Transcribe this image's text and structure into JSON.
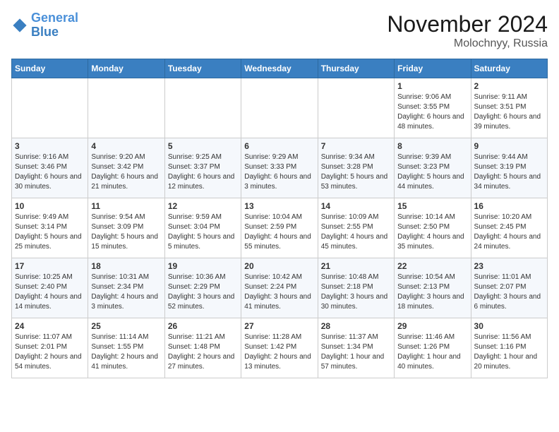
{
  "header": {
    "logo_line1": "General",
    "logo_line2": "Blue",
    "month": "November 2024",
    "location": "Molochnyy, Russia"
  },
  "days_of_week": [
    "Sunday",
    "Monday",
    "Tuesday",
    "Wednesday",
    "Thursday",
    "Friday",
    "Saturday"
  ],
  "weeks": [
    [
      {
        "day": "",
        "info": ""
      },
      {
        "day": "",
        "info": ""
      },
      {
        "day": "",
        "info": ""
      },
      {
        "day": "",
        "info": ""
      },
      {
        "day": "",
        "info": ""
      },
      {
        "day": "1",
        "info": "Sunrise: 9:06 AM\nSunset: 3:55 PM\nDaylight: 6 hours and 48 minutes."
      },
      {
        "day": "2",
        "info": "Sunrise: 9:11 AM\nSunset: 3:51 PM\nDaylight: 6 hours and 39 minutes."
      }
    ],
    [
      {
        "day": "3",
        "info": "Sunrise: 9:16 AM\nSunset: 3:46 PM\nDaylight: 6 hours and 30 minutes."
      },
      {
        "day": "4",
        "info": "Sunrise: 9:20 AM\nSunset: 3:42 PM\nDaylight: 6 hours and 21 minutes."
      },
      {
        "day": "5",
        "info": "Sunrise: 9:25 AM\nSunset: 3:37 PM\nDaylight: 6 hours and 12 minutes."
      },
      {
        "day": "6",
        "info": "Sunrise: 9:29 AM\nSunset: 3:33 PM\nDaylight: 6 hours and 3 minutes."
      },
      {
        "day": "7",
        "info": "Sunrise: 9:34 AM\nSunset: 3:28 PM\nDaylight: 5 hours and 53 minutes."
      },
      {
        "day": "8",
        "info": "Sunrise: 9:39 AM\nSunset: 3:23 PM\nDaylight: 5 hours and 44 minutes."
      },
      {
        "day": "9",
        "info": "Sunrise: 9:44 AM\nSunset: 3:19 PM\nDaylight: 5 hours and 34 minutes."
      }
    ],
    [
      {
        "day": "10",
        "info": "Sunrise: 9:49 AM\nSunset: 3:14 PM\nDaylight: 5 hours and 25 minutes."
      },
      {
        "day": "11",
        "info": "Sunrise: 9:54 AM\nSunset: 3:09 PM\nDaylight: 5 hours and 15 minutes."
      },
      {
        "day": "12",
        "info": "Sunrise: 9:59 AM\nSunset: 3:04 PM\nDaylight: 5 hours and 5 minutes."
      },
      {
        "day": "13",
        "info": "Sunrise: 10:04 AM\nSunset: 2:59 PM\nDaylight: 4 hours and 55 minutes."
      },
      {
        "day": "14",
        "info": "Sunrise: 10:09 AM\nSunset: 2:55 PM\nDaylight: 4 hours and 45 minutes."
      },
      {
        "day": "15",
        "info": "Sunrise: 10:14 AM\nSunset: 2:50 PM\nDaylight: 4 hours and 35 minutes."
      },
      {
        "day": "16",
        "info": "Sunrise: 10:20 AM\nSunset: 2:45 PM\nDaylight: 4 hours and 24 minutes."
      }
    ],
    [
      {
        "day": "17",
        "info": "Sunrise: 10:25 AM\nSunset: 2:40 PM\nDaylight: 4 hours and 14 minutes."
      },
      {
        "day": "18",
        "info": "Sunrise: 10:31 AM\nSunset: 2:34 PM\nDaylight: 4 hours and 3 minutes."
      },
      {
        "day": "19",
        "info": "Sunrise: 10:36 AM\nSunset: 2:29 PM\nDaylight: 3 hours and 52 minutes."
      },
      {
        "day": "20",
        "info": "Sunrise: 10:42 AM\nSunset: 2:24 PM\nDaylight: 3 hours and 41 minutes."
      },
      {
        "day": "21",
        "info": "Sunrise: 10:48 AM\nSunset: 2:18 PM\nDaylight: 3 hours and 30 minutes."
      },
      {
        "day": "22",
        "info": "Sunrise: 10:54 AM\nSunset: 2:13 PM\nDaylight: 3 hours and 18 minutes."
      },
      {
        "day": "23",
        "info": "Sunrise: 11:01 AM\nSunset: 2:07 PM\nDaylight: 3 hours and 6 minutes."
      }
    ],
    [
      {
        "day": "24",
        "info": "Sunrise: 11:07 AM\nSunset: 2:01 PM\nDaylight: 2 hours and 54 minutes."
      },
      {
        "day": "25",
        "info": "Sunrise: 11:14 AM\nSunset: 1:55 PM\nDaylight: 2 hours and 41 minutes."
      },
      {
        "day": "26",
        "info": "Sunrise: 11:21 AM\nSunset: 1:48 PM\nDaylight: 2 hours and 27 minutes."
      },
      {
        "day": "27",
        "info": "Sunrise: 11:28 AM\nSunset: 1:42 PM\nDaylight: 2 hours and 13 minutes."
      },
      {
        "day": "28",
        "info": "Sunrise: 11:37 AM\nSunset: 1:34 PM\nDaylight: 1 hour and 57 minutes."
      },
      {
        "day": "29",
        "info": "Sunrise: 11:46 AM\nSunset: 1:26 PM\nDaylight: 1 hour and 40 minutes."
      },
      {
        "day": "30",
        "info": "Sunrise: 11:56 AM\nSunset: 1:16 PM\nDaylight: 1 hour and 20 minutes."
      }
    ]
  ]
}
